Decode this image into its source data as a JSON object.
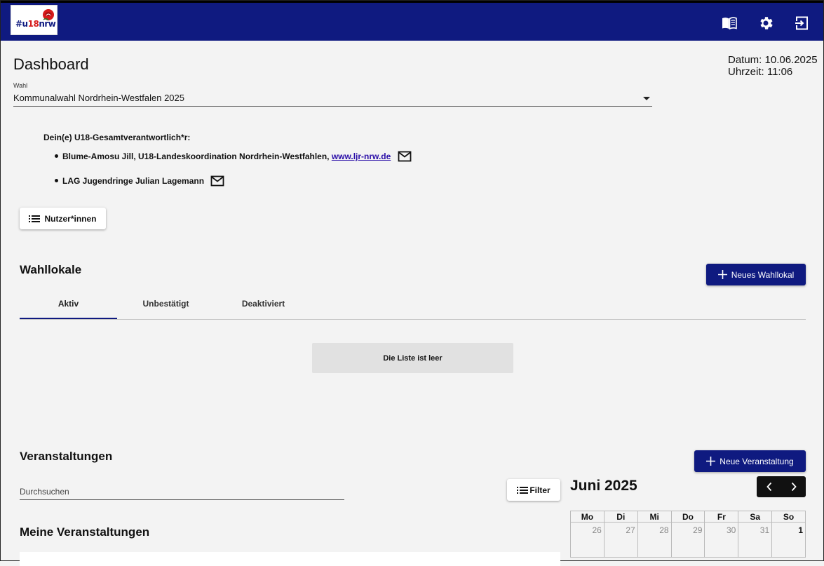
{
  "header": {
    "logo_text_prefix": "#u",
    "logo_text_number": "18",
    "logo_text_suffix": "nrw",
    "brand_color": "#0f1a80",
    "accent_color": "#d61b1b",
    "icons": [
      "book-open-icon",
      "gear-icon",
      "logout-icon"
    ]
  },
  "page": {
    "title": "Dashboard",
    "date_label": "Datum: 10.06.2025",
    "time_label": "Uhrzeit: 11:06"
  },
  "election_select": {
    "label": "Wahl",
    "value": "Kommunalwahl Nordrhein-Westfalen 2025"
  },
  "responsibles": {
    "heading": "Dein(e) U18-Gesamtverantwortlich*r:",
    "items": [
      {
        "text": "Blume-Amosu Jill, U18-Landeskoordination Nordrhein-Westfahlen, ",
        "link": "www.ljr-nrw.de"
      },
      {
        "text": "LAG Jugendringe Julian Lagemann",
        "link": ""
      }
    ]
  },
  "users_button": {
    "label": "Nutzer*innen"
  },
  "wahllokale": {
    "title": "Wahllokale",
    "new_button": "Neues Wahllokal",
    "tabs": [
      "Aktiv",
      "Unbestätigt",
      "Deaktiviert"
    ],
    "active_tab": "Aktiv",
    "empty_text": "Die Liste ist leer"
  },
  "veranstaltungen": {
    "title": "Veranstaltungen",
    "new_button": "Neue Veranstaltung",
    "search_placeholder": "Durchsuchen",
    "filter_button": "Filter",
    "my_events_title": "Meine Veranstaltungen"
  },
  "calendar": {
    "month_label": "Juni 2025",
    "weekdays": [
      "Mo",
      "Di",
      "Mi",
      "Do",
      "Fr",
      "Sa",
      "So"
    ],
    "first_row": [
      "26",
      "27",
      "28",
      "29",
      "30",
      "31",
      "1"
    ]
  }
}
